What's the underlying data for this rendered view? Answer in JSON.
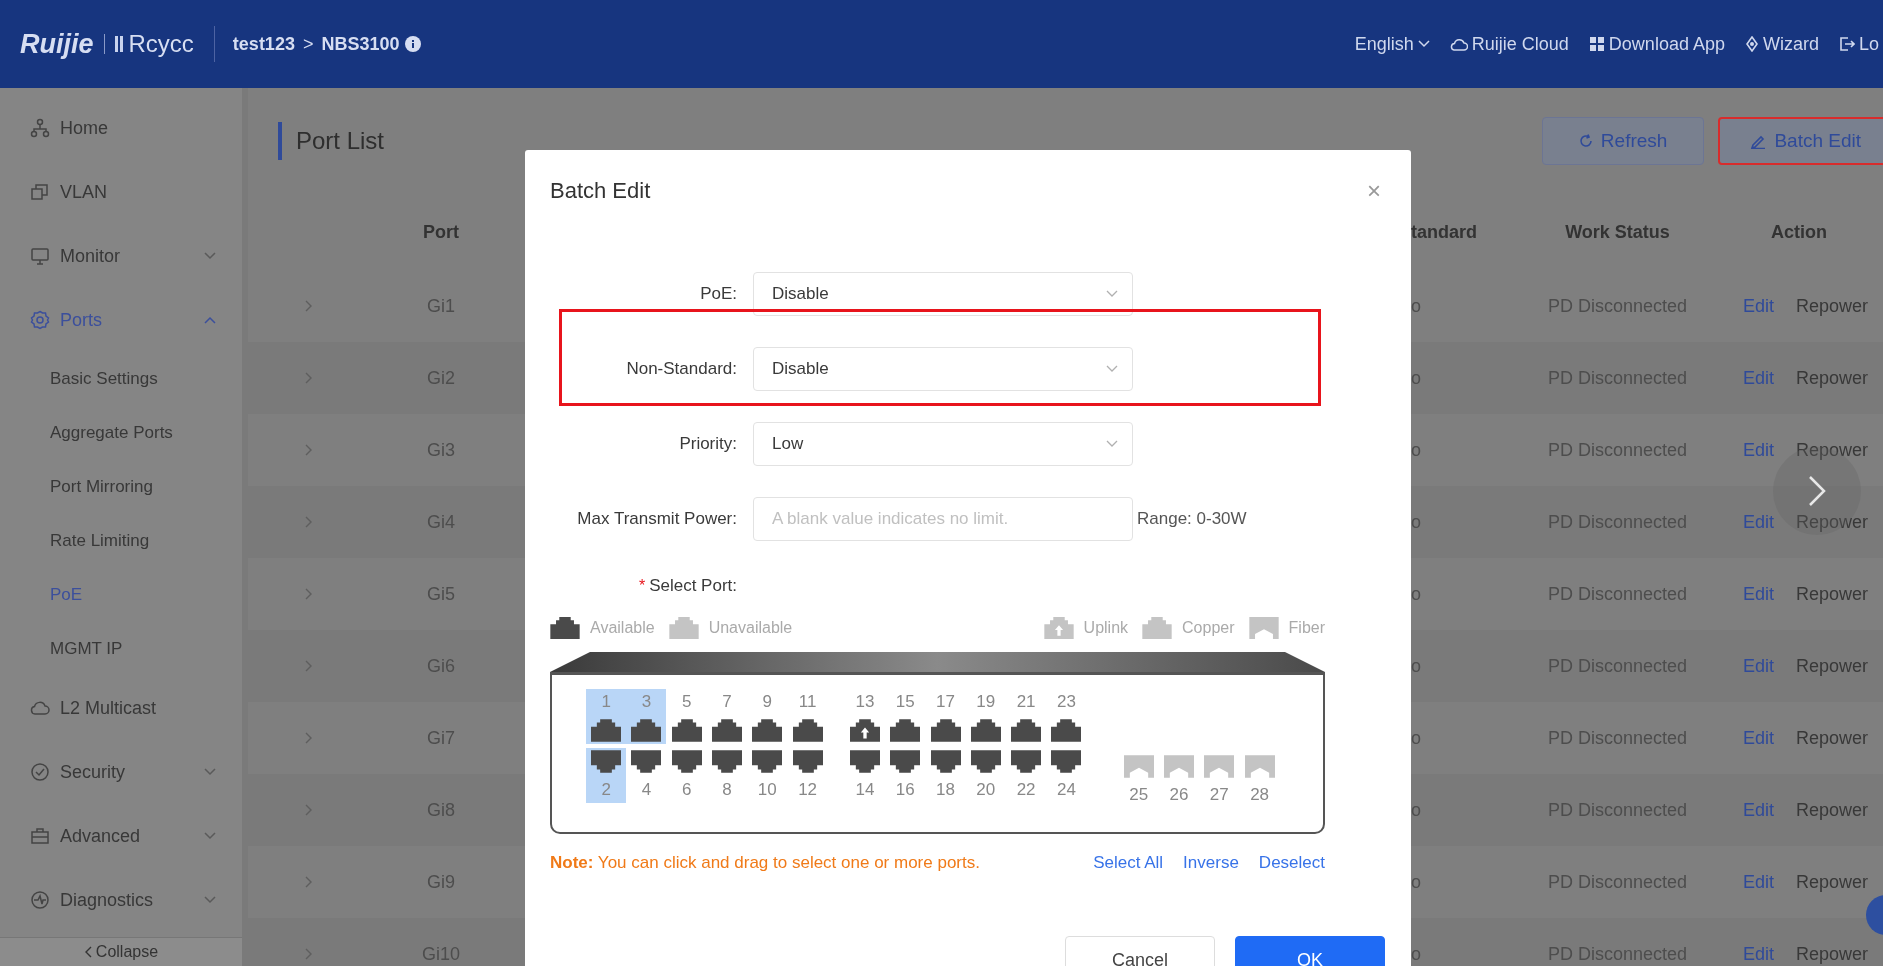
{
  "header": {
    "logo": "Ruijie",
    "brand": "Rcycc",
    "breadcrumb": [
      {
        "text": "test123",
        "kind": "link"
      },
      {
        "text": ">",
        "kind": "separator"
      },
      {
        "text": "NBS3100",
        "kind": "current"
      }
    ],
    "actions": [
      {
        "label": "English",
        "kind": "language"
      },
      {
        "label": "Ruijie Cloud",
        "kind": "cloud"
      },
      {
        "label": "Download App",
        "kind": "download"
      },
      {
        "label": "Wizard",
        "kind": "wizard"
      },
      {
        "label": "Lo",
        "kind": "logout"
      }
    ]
  },
  "sidebar": {
    "items": [
      {
        "label": "Home",
        "selected": false
      },
      {
        "label": "VLAN",
        "selected": false
      },
      {
        "label": "Monitor",
        "selected": false,
        "expanded": false
      },
      {
        "label": "Ports",
        "selected": true,
        "expanded": true,
        "children": [
          {
            "label": "Basic Settings",
            "selected": false
          },
          {
            "label": "Aggregate Ports",
            "selected": false
          },
          {
            "label": "Port Mirroring",
            "selected": false
          },
          {
            "label": "Rate Limiting",
            "selected": false
          },
          {
            "label": "PoE",
            "selected": true
          },
          {
            "label": "MGMT IP",
            "selected": false
          }
        ]
      },
      {
        "label": "L2 Multicast",
        "selected": false
      },
      {
        "label": "Security",
        "selected": false,
        "expanded": false
      },
      {
        "label": "Advanced",
        "selected": false,
        "expanded": false
      },
      {
        "label": "Diagnostics",
        "selected": false,
        "expanded": false
      }
    ],
    "collapse": "Collapse"
  },
  "page": {
    "title": "Port List",
    "buttons": [
      {
        "label": "Refresh",
        "kind": "refresh",
        "highlighted": false
      },
      {
        "label": "Batch Edit",
        "kind": "edit",
        "highlighted": true
      }
    ]
  },
  "table": {
    "columns": [
      "Port",
      "tandard",
      "Work Status",
      "Action"
    ],
    "rows": [
      {
        "port": "Gi1",
        "column_3": "o",
        "work_status": "PD Disconnected",
        "actions": [
          "Edit",
          "Repower"
        ]
      },
      {
        "port": "Gi2",
        "column_3": "o",
        "work_status": "PD Disconnected",
        "actions": [
          "Edit",
          "Repower"
        ]
      },
      {
        "port": "Gi3",
        "column_3": "o",
        "work_status": "PD Disconnected",
        "actions": [
          "Edit",
          "Repower"
        ]
      },
      {
        "port": "Gi4",
        "column_3": "o",
        "work_status": "PD Disconnected",
        "actions": [
          "Edit",
          "Repower"
        ]
      },
      {
        "port": "Gi5",
        "column_3": "o",
        "work_status": "PD Disconnected",
        "actions": [
          "Edit",
          "Repower"
        ]
      },
      {
        "port": "Gi6",
        "column_3": "o",
        "work_status": "PD Disconnected",
        "actions": [
          "Edit",
          "Repower"
        ]
      },
      {
        "port": "Gi7",
        "column_3": "o",
        "work_status": "PD Disconnected",
        "actions": [
          "Edit",
          "Repower"
        ]
      },
      {
        "port": "Gi8",
        "column_3": "o",
        "work_status": "PD Disconnected",
        "actions": [
          "Edit",
          "Repower"
        ]
      },
      {
        "port": "Gi9",
        "column_3": "o",
        "work_status": "PD Disconnected",
        "actions": [
          "Edit",
          "Repower"
        ]
      },
      {
        "port": "Gi10",
        "column_3": "o",
        "work_status": "PD Disconnected",
        "actions": [
          "Edit",
          "Repower"
        ]
      }
    ]
  },
  "dialog": {
    "title": "Batch Edit",
    "close": "×",
    "fields": [
      {
        "label": "PoE:",
        "kind": "select",
        "value": "Disable",
        "highlighted": false
      },
      {
        "label": "Non-Standard:",
        "kind": "select",
        "value": "Disable",
        "highlighted": true
      },
      {
        "label": "Priority:",
        "kind": "select",
        "value": "Low",
        "highlighted": false
      },
      {
        "label": "Max Transmit Power:",
        "kind": "input",
        "placeholder": "A blank value indicates no limit.",
        "hint": "Range: 0-30W",
        "highlighted": false
      }
    ],
    "select_port": {
      "required": "*",
      "label": "Select Port:"
    },
    "legend_left": [
      {
        "label": "Available",
        "kind": "copper",
        "available": true
      },
      {
        "label": "Unavailable",
        "kind": "copper",
        "available": false
      }
    ],
    "legend_right": [
      {
        "label": "Uplink",
        "kind": "uplink",
        "available": false
      },
      {
        "label": "Copper",
        "kind": "copper",
        "available": false
      },
      {
        "label": "Fiber",
        "kind": "fiber",
        "available": false
      }
    ],
    "port_groups": [
      {
        "columns": [
          {
            "top": {
              "number": "1",
              "kind": "copper",
              "available": true,
              "selected": true
            },
            "bottom": {
              "number": "2",
              "kind": "copper",
              "available": true,
              "selected": true
            }
          },
          {
            "top": {
              "number": "3",
              "kind": "copper",
              "available": true,
              "selected": true
            },
            "bottom": {
              "number": "4",
              "kind": "copper",
              "available": true,
              "selected": false
            }
          },
          {
            "top": {
              "number": "5",
              "kind": "copper",
              "available": true,
              "selected": false
            },
            "bottom": {
              "number": "6",
              "kind": "copper",
              "available": true,
              "selected": false
            }
          },
          {
            "top": {
              "number": "7",
              "kind": "copper",
              "available": true,
              "selected": false
            },
            "bottom": {
              "number": "8",
              "kind": "copper",
              "available": true,
              "selected": false
            }
          },
          {
            "top": {
              "number": "9",
              "kind": "copper",
              "available": true,
              "selected": false
            },
            "bottom": {
              "number": "10",
              "kind": "copper",
              "available": true,
              "selected": false
            }
          },
          {
            "top": {
              "number": "11",
              "kind": "copper",
              "available": true,
              "selected": false
            },
            "bottom": {
              "number": "12",
              "kind": "copper",
              "available": true,
              "selected": false
            }
          }
        ]
      },
      {
        "columns": [
          {
            "top": {
              "number": "13",
              "kind": "uplink",
              "available": true,
              "selected": false
            },
            "bottom": {
              "number": "14",
              "kind": "copper",
              "available": true,
              "selected": false
            }
          },
          {
            "top": {
              "number": "15",
              "kind": "copper",
              "available": true,
              "selected": false
            },
            "bottom": {
              "number": "16",
              "kind": "copper",
              "available": true,
              "selected": false
            }
          },
          {
            "top": {
              "number": "17",
              "kind": "copper",
              "available": true,
              "selected": false
            },
            "bottom": {
              "number": "18",
              "kind": "copper",
              "available": true,
              "selected": false
            }
          },
          {
            "top": {
              "number": "19",
              "kind": "copper",
              "available": true,
              "selected": false
            },
            "bottom": {
              "number": "20",
              "kind": "copper",
              "available": true,
              "selected": false
            }
          },
          {
            "top": {
              "number": "21",
              "kind": "copper",
              "available": true,
              "selected": false
            },
            "bottom": {
              "number": "22",
              "kind": "copper",
              "available": true,
              "selected": false
            }
          },
          {
            "top": {
              "number": "23",
              "kind": "copper",
              "available": true,
              "selected": false
            },
            "bottom": {
              "number": "24",
              "kind": "copper",
              "available": true,
              "selected": false
            }
          }
        ]
      },
      {
        "columns": [
          {
            "bottom": {
              "number": "25",
              "kind": "fiber",
              "available": false,
              "selected": false
            }
          },
          {
            "bottom": {
              "number": "26",
              "kind": "fiber",
              "available": false,
              "selected": false
            }
          },
          {
            "bottom": {
              "number": "27",
              "kind": "fiber",
              "available": false,
              "selected": false
            }
          },
          {
            "bottom": {
              "number": "28",
              "kind": "fiber",
              "available": false,
              "selected": false
            }
          }
        ]
      }
    ],
    "note": "**Note:** You can click and drag to select one or more ports.",
    "links": [
      "Select All",
      "Inverse",
      "Deselect"
    ],
    "buttons": [
      {
        "label": "Cancel",
        "kind": "secondary"
      },
      {
        "label": "OK",
        "kind": "primary"
      }
    ]
  }
}
